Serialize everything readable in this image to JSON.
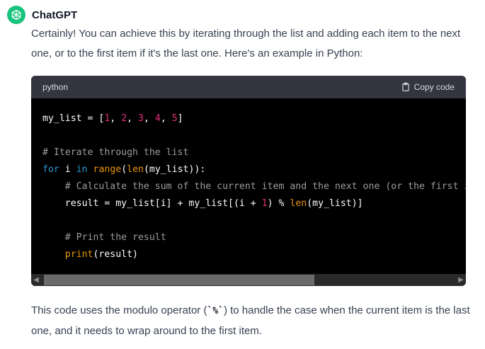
{
  "message": {
    "author": "ChatGPT",
    "intro": "Certainly! You can achieve this by iterating through the list and adding each item to the next one, or to the first item if it's the last one. Here's an example in Python:",
    "outro_before": "This code uses the modulo operator (",
    "outro_code": "`%`",
    "outro_after": ") to handle the case when the current item is the last one, and it needs to wrap around to the first item."
  },
  "codeblock": {
    "language": "python",
    "copy_label": "Copy code",
    "lines": {
      "l1": {
        "a": "my_list = [",
        "n1": "1",
        "s1": ", ",
        "n2": "2",
        "s2": ", ",
        "n3": "3",
        "s3": ", ",
        "n4": "4",
        "s4": ", ",
        "n5": "5",
        "b": "]"
      },
      "l3": {
        "c": "# Iterate through the list"
      },
      "l4": {
        "k1": "for",
        "a": " i ",
        "k2": "in",
        "s": " ",
        "f1": "range",
        "p1": "(",
        "f2": "len",
        "b": "(my_list)):"
      },
      "l5": {
        "indent": "    ",
        "c": "# Calculate the sum of the current item and the next one (or the first item if it's the last one)"
      },
      "l6": {
        "a": "    result = my_list[i] + my_list[(i + ",
        "n": "1",
        "b": ") % ",
        "f": "len",
        "c": "(my_list)]"
      },
      "l8": {
        "indent": "    ",
        "c": "# Print the result"
      },
      "l9": {
        "indent": "    ",
        "f": "print",
        "b": "(result)"
      }
    }
  },
  "icons": {
    "avatar": "openai-logo-icon",
    "copy": "clipboard-icon",
    "scroll_left": "chevron-left-icon",
    "scroll_right": "chevron-right-icon"
  },
  "colors": {
    "avatar_bg": "#19c37d",
    "code_bg": "#000000",
    "code_header_bg": "#343541",
    "comment": "#9c9c9c",
    "keyword": "#2e95d3",
    "builtin": "#e9950c",
    "number": "#df3079"
  }
}
